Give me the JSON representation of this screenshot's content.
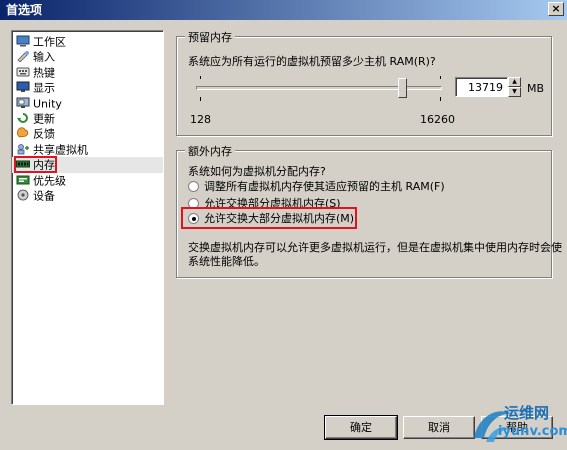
{
  "window": {
    "title": "首选项",
    "close_glyph": "×"
  },
  "sidebar": {
    "items": [
      {
        "label": "工作区",
        "icon": "workspace-icon",
        "selected": false
      },
      {
        "label": "输入",
        "icon": "input-icon",
        "selected": false
      },
      {
        "label": "热键",
        "icon": "hotkey-icon",
        "selected": false
      },
      {
        "label": "显示",
        "icon": "display-icon",
        "selected": false
      },
      {
        "label": "Unity",
        "icon": "unity-icon",
        "selected": false
      },
      {
        "label": "更新",
        "icon": "update-icon",
        "selected": false
      },
      {
        "label": "反馈",
        "icon": "feedback-icon",
        "selected": false
      },
      {
        "label": "共享虚拟机",
        "icon": "shared-vm-icon",
        "selected": false
      },
      {
        "label": "内存",
        "icon": "memory-icon",
        "selected": true
      },
      {
        "label": "优先级",
        "icon": "priority-icon",
        "selected": false
      },
      {
        "label": "设备",
        "icon": "device-icon",
        "selected": false
      }
    ]
  },
  "reserved_memory": {
    "title": "预留内存",
    "prompt": "系统应为所有运行的虚拟机预留多少主机 RAM(R)?",
    "slider_min": "128",
    "slider_max": "16260",
    "slider_value": 13719,
    "value": "13719",
    "unit": "MB"
  },
  "extra_memory": {
    "title": "额外内存",
    "prompt": "系统如何为虚拟机分配内存?",
    "options": [
      {
        "label": "调整所有虚拟机内存使其适应预留的主机 RAM(F)",
        "checked": false
      },
      {
        "label": "允许交换部分虚拟机内存(S)",
        "checked": false
      },
      {
        "label": "允许交换大部分虚拟机内存(M)",
        "checked": true
      }
    ],
    "description_line1": "交换虚拟机内存可以允许更多虚拟机运行，但是在虚拟机集中使用内存时会使",
    "description_line2": "系统性能降低。"
  },
  "buttons": {
    "ok": "确定",
    "cancel": "取消",
    "help": "帮助"
  },
  "watermark": {
    "text1": "运维网",
    "text2": "iyunv.com"
  },
  "colors": {
    "highlight": "#e0141e",
    "titlebar": "#0a246a"
  }
}
